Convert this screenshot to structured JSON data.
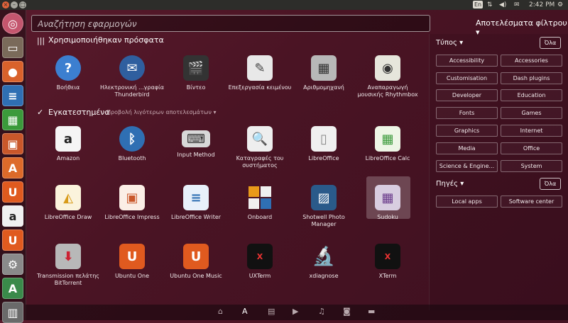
{
  "topbar": {
    "lang": "En",
    "network": "⇅",
    "volume": "◀)",
    "mail": "✉",
    "time": "2:42 PM",
    "gear": "⚙"
  },
  "search": {
    "placeholder": "Αναζήτηση εφαρμογών"
  },
  "filter_results_label": "Αποτελέσματα φίλτρου ▾",
  "sections": {
    "recent": {
      "title": "Χρησιμοποιήθηκαν πρόσφατα",
      "apps": [
        {
          "label": "Βοήθεια",
          "icon": "help-icon"
        },
        {
          "label": "Ηλεκτρονική ...γραφία Thunderbird",
          "icon": "thunderbird-icon"
        },
        {
          "label": "Βίντεο",
          "icon": "video-icon"
        },
        {
          "label": "Επεξεργασία κειμένου",
          "icon": "text-editor-icon"
        },
        {
          "label": "Αριθμομηχανή",
          "icon": "calculator-icon"
        },
        {
          "label": "Αναπαραγωγή μουσικής Rhythmbox",
          "icon": "rhythmbox-icon"
        }
      ]
    },
    "installed": {
      "title": "Εγκατεστημένα",
      "more": "Προβολή λιγότερων αποτελεσμάτων ▾",
      "apps": [
        {
          "label": "Amazon",
          "icon": "amazon-icon"
        },
        {
          "label": "Bluetooth",
          "icon": "bluetooth-icon"
        },
        {
          "label": "Input Method",
          "icon": "keyboard-icon"
        },
        {
          "label": "Καταγραφές του συστήματος",
          "icon": "log-viewer-icon"
        },
        {
          "label": "LibreOffice",
          "icon": "libreoffice-icon"
        },
        {
          "label": "LibreOffice Calc",
          "icon": "calc-icon"
        },
        {
          "label": "LibreOffice Draw",
          "icon": "draw-icon"
        },
        {
          "label": "LibreOffice Impress",
          "icon": "impress-icon"
        },
        {
          "label": "LibreOffice Writer",
          "icon": "writer-icon"
        },
        {
          "label": "Onboard",
          "icon": "onboard-icon"
        },
        {
          "label": "Shotwell Photo Manager",
          "icon": "shotwell-icon"
        },
        {
          "label": "Sudoku",
          "icon": "sudoku-icon"
        },
        {
          "label": "Transmission πελάτης BitTorrent",
          "icon": "transmission-icon"
        },
        {
          "label": "Ubuntu One",
          "icon": "ubuntu-one-icon"
        },
        {
          "label": "Ubuntu One Music",
          "icon": "ubuntu-one-music-icon"
        },
        {
          "label": "UXTerm",
          "icon": "uxterm-icon"
        },
        {
          "label": "xdiagnose",
          "icon": "microscope-icon"
        },
        {
          "label": "XTerm",
          "icon": "xterm-icon"
        }
      ]
    }
  },
  "filters": {
    "type": {
      "title": "Τύπος ▾",
      "all": "Όλα",
      "items": [
        "Accessibility",
        "Accessories",
        "Customisation",
        "Dash plugins",
        "Developer",
        "Education",
        "Fonts",
        "Games",
        "Graphics",
        "Internet",
        "Media",
        "Office",
        "Science & Engine...",
        "System"
      ]
    },
    "sources": {
      "title": "Πηγές ▾",
      "all": "Όλα",
      "items": [
        "Local apps",
        "Software center"
      ]
    }
  },
  "launcher": {
    "items": [
      "dash-home-icon",
      "files-icon",
      "firefox-icon",
      "writer-icon",
      "calc-icon",
      "impress-icon",
      "software-center-icon",
      "ubuntu-one-icon",
      "amazon-icon",
      "ubuntu-one-music-icon",
      "settings-icon",
      "updates-icon",
      "trash-icon"
    ]
  },
  "lenses": [
    "home-lens-icon",
    "apps-lens-icon",
    "files-lens-icon",
    "video-lens-icon",
    "music-lens-icon",
    "photos-lens-icon",
    "social-lens-icon"
  ],
  "colors": {
    "background": "#4a1424",
    "accent": "#e0633a"
  }
}
